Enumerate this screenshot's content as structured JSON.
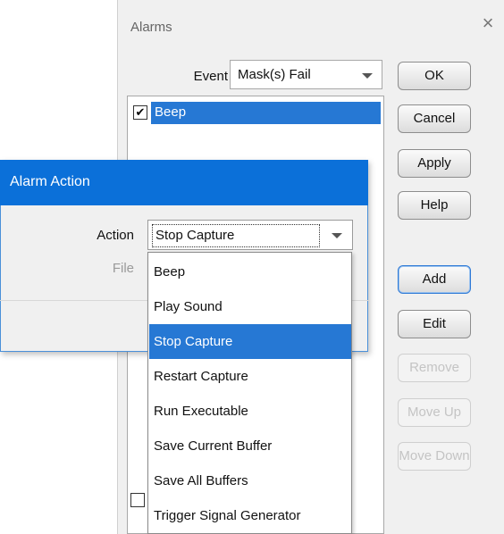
{
  "alarms_window": {
    "title": "Alarms",
    "close_glyph": "×",
    "event_label": "Event",
    "event_value": "Mask(s) Fail",
    "list_items": [
      {
        "label": "Beep",
        "checked": true
      }
    ],
    "buttons": {
      "ok": "OK",
      "cancel": "Cancel",
      "apply": "Apply",
      "help": "Help",
      "add": "Add",
      "edit": "Edit",
      "remove": "Remove",
      "move_up": "Move Up",
      "move_down": "Move Down"
    }
  },
  "action_dialog": {
    "title": "Alarm Action",
    "action_label": "Action",
    "action_value": "Stop Capture",
    "file_label": "File"
  },
  "dropdown_options": [
    "Beep",
    "Play Sound",
    "Stop Capture",
    "Restart Capture",
    "Run Executable",
    "Save Current Buffer",
    "Save All Buffers",
    "Trigger Signal Generator"
  ],
  "selected_option": "Stop Capture",
  "colors": {
    "selection": "#2678d4",
    "titlebar": "#0b70d9"
  }
}
